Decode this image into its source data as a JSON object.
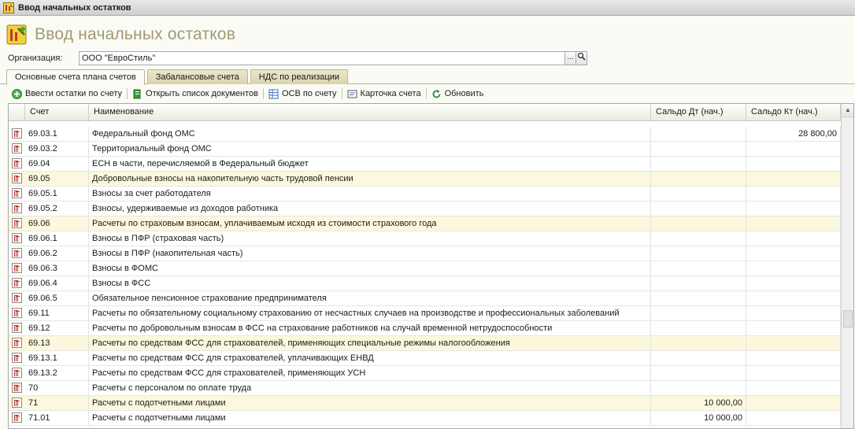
{
  "window": {
    "title": "Ввод начальных остатков"
  },
  "page_title": "Ввод начальных остатков",
  "organization": {
    "label": "Организация:",
    "value": "ООО \"ЕвроСтиль\"",
    "select_glyph": "...",
    "search_icon": "magnifier-icon"
  },
  "tabs": [
    {
      "label": "Основные счета плана счетов",
      "active": true
    },
    {
      "label": "Забалансовые счета",
      "active": false
    },
    {
      "label": "НДС по реализации",
      "active": false
    }
  ],
  "toolbar": {
    "enter_balances": "Ввести остатки по счету",
    "open_documents": "Открыть список документов",
    "osv": "ОСВ по счету",
    "account_card": "Карточка счета",
    "refresh": "Обновить"
  },
  "table": {
    "headers": {
      "account": "Счет",
      "name": "Наименование",
      "dt": "Сальдо Дт (нач.)",
      "kt": "Сальдо Кт (нач.)"
    },
    "rows": [
      {
        "account": "69.03.1",
        "name": "Федеральный фонд ОМС",
        "dt": "",
        "kt": "28 800,00",
        "highlight": false
      },
      {
        "account": "69.03.2",
        "name": "Территориальный фонд ОМС",
        "dt": "",
        "kt": "",
        "highlight": false
      },
      {
        "account": "69.04",
        "name": "ЕСН в части, перечисляемой в Федеральный бюджет",
        "dt": "",
        "kt": "",
        "highlight": false
      },
      {
        "account": "69.05",
        "name": "Добровольные взносы на накопительную часть трудовой пенсии",
        "dt": "",
        "kt": "",
        "highlight": true
      },
      {
        "account": "69.05.1",
        "name": "Взносы за счет работодателя",
        "dt": "",
        "kt": "",
        "highlight": false
      },
      {
        "account": "69.05.2",
        "name": "Взносы, удерживаемые из доходов работника",
        "dt": "",
        "kt": "",
        "highlight": false
      },
      {
        "account": "69.06",
        "name": "Расчеты по страховым взносам, уплачиваемым исходя из стоимости страхового года",
        "dt": "",
        "kt": "",
        "highlight": true
      },
      {
        "account": "69.06.1",
        "name": "Взносы в ПФР (страховая часть)",
        "dt": "",
        "kt": "",
        "highlight": false
      },
      {
        "account": "69.06.2",
        "name": "Взносы в ПФР (накопительная часть)",
        "dt": "",
        "kt": "",
        "highlight": false
      },
      {
        "account": "69.06.3",
        "name": "Взносы в ФОМС",
        "dt": "",
        "kt": "",
        "highlight": false
      },
      {
        "account": "69.06.4",
        "name": "Взносы в ФСС",
        "dt": "",
        "kt": "",
        "highlight": false
      },
      {
        "account": "69.06.5",
        "name": "Обязательное пенсионное страхование предпринимателя",
        "dt": "",
        "kt": "",
        "highlight": false
      },
      {
        "account": "69.11",
        "name": "Расчеты по обязательному социальному страхованию от несчастных случаев на производстве и профессиональных заболеваний",
        "dt": "",
        "kt": "",
        "highlight": false
      },
      {
        "account": "69.12",
        "name": "Расчеты по добровольным взносам в ФСС на страхование работников на случай временной нетрудоспособности",
        "dt": "",
        "kt": "",
        "highlight": false
      },
      {
        "account": "69.13",
        "name": "Расчеты по средствам ФСС для страхователей, применяющих специальные режимы налогообложения",
        "dt": "",
        "kt": "",
        "highlight": true
      },
      {
        "account": "69.13.1",
        "name": "Расчеты по средствам ФСС для страхователей, уплачивающих ЕНВД",
        "dt": "",
        "kt": "",
        "highlight": false
      },
      {
        "account": "69.13.2",
        "name": "Расчеты по средствам ФСС для страхователей, применяющих УСН",
        "dt": "",
        "kt": "",
        "highlight": false
      },
      {
        "account": "70",
        "name": "Расчеты с персоналом по оплате труда",
        "dt": "",
        "kt": "",
        "highlight": false,
        "group": true
      },
      {
        "account": "71",
        "name": "Расчеты с подотчетными лицами",
        "dt": "10 000,00",
        "kt": "",
        "highlight": true
      },
      {
        "account": "71.01",
        "name": "Расчеты с подотчетными лицами",
        "dt": "10 000,00",
        "kt": "",
        "highlight": false
      }
    ]
  }
}
